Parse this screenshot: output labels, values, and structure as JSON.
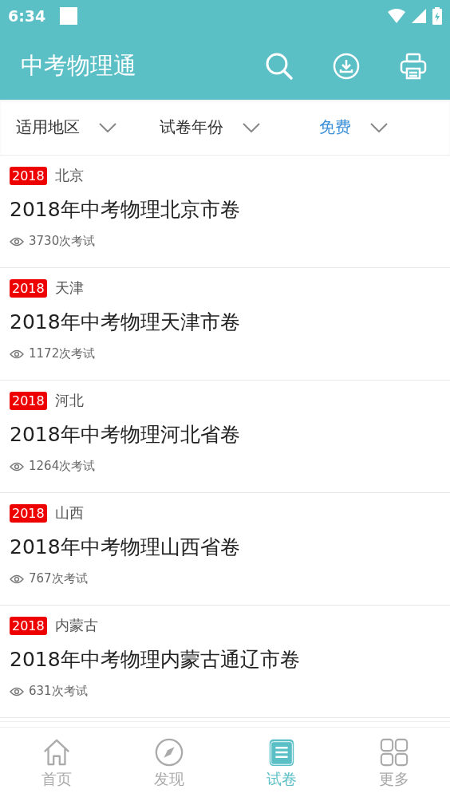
{
  "status_bar": {
    "time": "6:34"
  },
  "app_bar": {
    "title": "中考物理通"
  },
  "filters": [
    {
      "label": "适用地区",
      "selected": false
    },
    {
      "label": "试卷年份",
      "selected": false
    },
    {
      "label": "免费",
      "selected": true
    }
  ],
  "papers": [
    {
      "year": "2018",
      "region": "北京",
      "title": "2018年中考物理北京市卷",
      "views": "3730次考试"
    },
    {
      "year": "2018",
      "region": "天津",
      "title": "2018年中考物理天津市卷",
      "views": "1172次考试"
    },
    {
      "year": "2018",
      "region": "河北",
      "title": "2018年中考物理河北省卷",
      "views": "1264次考试"
    },
    {
      "year": "2018",
      "region": "山西",
      "title": "2018年中考物理山西省卷",
      "views": "767次考试"
    },
    {
      "year": "2018",
      "region": "内蒙古",
      "title": "2018年中考物理内蒙古通辽市卷",
      "views": "631次考试"
    }
  ],
  "bottom_nav": [
    {
      "label": "首页",
      "kind": "home",
      "selected": false
    },
    {
      "label": "发现",
      "kind": "discover",
      "selected": false
    },
    {
      "label": "试卷",
      "kind": "papers",
      "selected": true
    },
    {
      "label": "更多",
      "kind": "more",
      "selected": false
    }
  ]
}
